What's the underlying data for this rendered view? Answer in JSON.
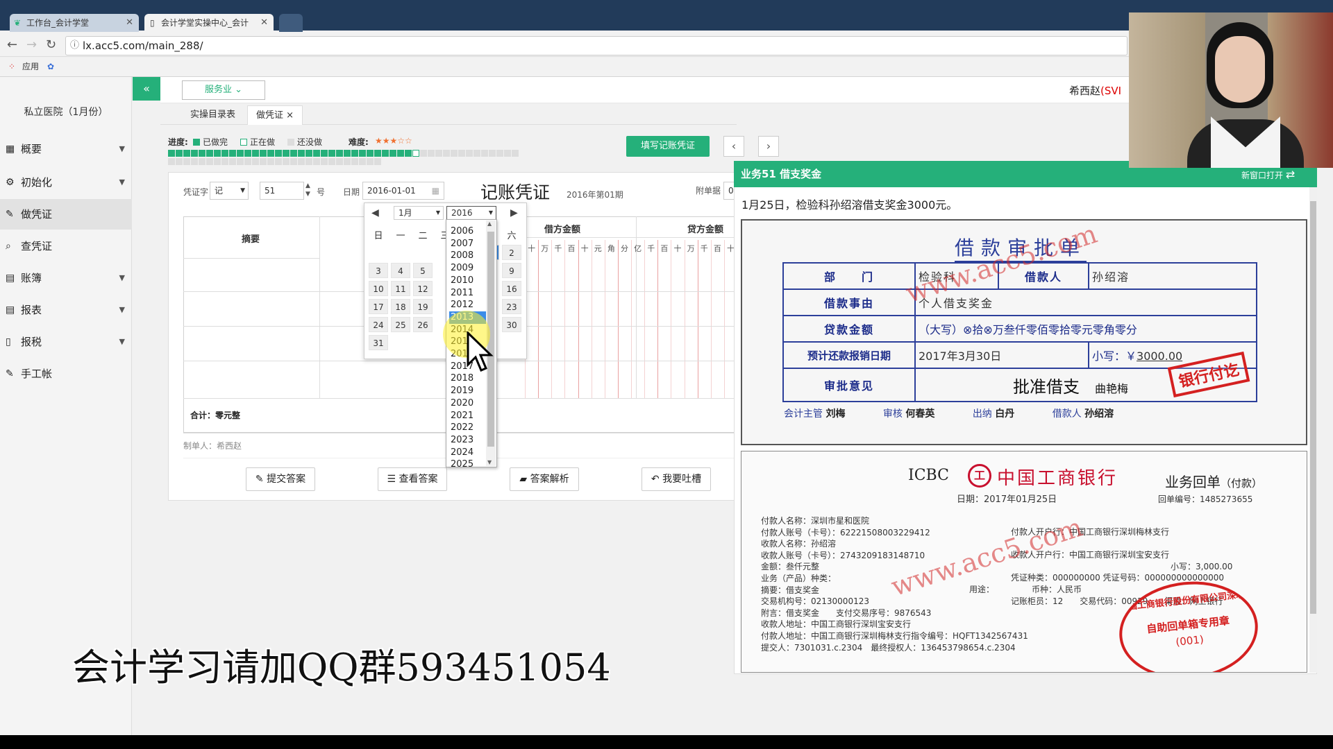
{
  "browser": {
    "tabs": [
      {
        "label": "工作台_会计学堂"
      },
      {
        "label": "会计学堂实操中心_会计"
      },
      {
        "label": ""
      }
    ],
    "url": "lx.acc5.com/main_288/",
    "bookmarks": {
      "apps": "应用"
    }
  },
  "sidebar": {
    "hospital": "私立医院（1月份）",
    "items": [
      {
        "label": "概要"
      },
      {
        "label": "初始化"
      },
      {
        "label": "做凭证"
      },
      {
        "label": "查凭证"
      },
      {
        "label": "账簿"
      },
      {
        "label": "报表"
      },
      {
        "label": "报税"
      },
      {
        "label": "手工帐"
      }
    ]
  },
  "topbar": {
    "collapse": "«",
    "industry": "服务业",
    "user": "希西赵",
    "user_suffix": "(SVI"
  },
  "subtabs": [
    {
      "label": "实操目录表"
    },
    {
      "label": "做凭证 ×"
    }
  ],
  "progress": {
    "label": "进度:",
    "done": "已做完",
    "doing": "正在做",
    "todo": "还没做",
    "difficulty": "难度:",
    "stars": "★★★☆☆",
    "done_count": 32,
    "total": 74
  },
  "toolbar": {
    "fill_button": "填写记账凭证",
    "prev": "‹",
    "next": "›"
  },
  "voucher": {
    "word_label": "凭证字",
    "word_value": "记",
    "number": "51",
    "number_suffix": "号",
    "date_label": "日期",
    "date_value": "2016-01-01",
    "title": "记账凭证",
    "period": "2016年第01期",
    "attach_label": "附单据",
    "attach_value": "0",
    "col_summary": "摘要",
    "col_debit": "借方金额",
    "col_credit": "贷方金额",
    "units": [
      "十",
      "万",
      "千",
      "百",
      "十",
      "元",
      "角",
      "分",
      "亿",
      "千",
      "百",
      "十",
      "万",
      "千",
      "百",
      "十"
    ],
    "total": "合计：零元整",
    "maker": "制单人：希西赵"
  },
  "actions": {
    "submit": "提交答案",
    "view": "查看答案",
    "explain": "答案解析",
    "feedback": "我要吐槽"
  },
  "datepicker": {
    "month": "1月",
    "year": "2016",
    "weekdays": [
      "日",
      "一",
      "二",
      "三",
      "四",
      "五",
      "六"
    ],
    "days": [
      "1",
      "2",
      "3",
      "4",
      "5",
      "9",
      "10",
      "11",
      "12",
      "16",
      "17",
      "18",
      "19",
      "23",
      "24",
      "25",
      "26",
      "30",
      "31"
    ],
    "years": [
      "2006",
      "2007",
      "2008",
      "2009",
      "2010",
      "2011",
      "2012",
      "2013",
      "2014",
      "2015",
      "2016",
      "2017",
      "2018",
      "2019",
      "2020",
      "2021",
      "2022",
      "2023",
      "2024",
      "2025"
    ],
    "selected_year": "2013"
  },
  "task": {
    "title": "业务51 借支奖金",
    "open_new": "新窗口打开",
    "description": "1月25日，检验科孙绍溶借支奖金3000元。"
  },
  "loan_form": {
    "title": "借款审批单",
    "dept_label": "部　　门",
    "dept": "检验科",
    "borrower_label": "借款人",
    "borrower": "孙绍溶",
    "reason_label": "借款事由",
    "reason": "个人借支奖金",
    "amount_label": "贷款金额",
    "amount_upper": "（大写）⊗拾⊗万叁仟零佰零拾零元零角零分",
    "due_label": "预计还款报销日期",
    "due": "2017年3月30日",
    "small_label": "小写：￥",
    "small": "3000.00",
    "approve_label": "审批意见",
    "approve": "批准借支",
    "approver": "曲艳梅",
    "stamp": "银行付讫",
    "sig_supervisor_label": "会计主管",
    "sig_supervisor": "刘梅",
    "sig_audit_label": "审核",
    "sig_audit": "何春英",
    "sig_cashier_label": "出纳",
    "sig_cashier": "白丹",
    "sig_borrower_label": "借款人",
    "sig_borrower": "孙绍溶"
  },
  "receipt": {
    "brand": "ICBC",
    "bank": "中国工商银行",
    "doc": "业务回单",
    "doc_type": "（付款）",
    "date": "日期：2017年01月25日",
    "receipt_no": "回单编号：1485273655",
    "lines_left": [
      "付款人名称：深圳市星和医院",
      "付款人账号（卡号）：62221508003229412",
      "收款人名称：孙绍溶",
      "收款人账号（卡号）：2743209183148710",
      "金额：叁仟元整",
      "业务（产品）种类：",
      "摘要：借支奖金",
      "交易机构号：02130000123",
      "附言：借支奖金　　支付交易序号：9876543",
      "收款人地址：中国工商银行深圳宝安支行",
      "付款人地址：中国工商银行深圳梅林支行指令编号：HQFT1342567431",
      "提交人：7301031.c.2304　最终授权人：136453798654.c.2304"
    ],
    "lines_right": [
      "付款人开户行：中国工商银行深圳梅林支行",
      "收款人开户行：中国工商银行深圳宝安支行",
      "小写：3,000.00",
      "凭证种类：000000000 凭证号码：000000000000000",
      "用途：　　　　　币种：人民币",
      "记账柜员：12　　交易代码：00929　　渠道：网上银行"
    ],
    "stamp_text": "中国工商银行股份有限公司深圳梅林支行",
    "stamp_inner": "自助回单箱专用章",
    "stamp_no": "(001)"
  },
  "watermark": "www.acc5.com",
  "overlay": "会计学习请加QQ群593451054",
  "colors": {
    "accent": "#25b07a",
    "danger": "#d42020",
    "form_blue": "#1c2c8a"
  }
}
